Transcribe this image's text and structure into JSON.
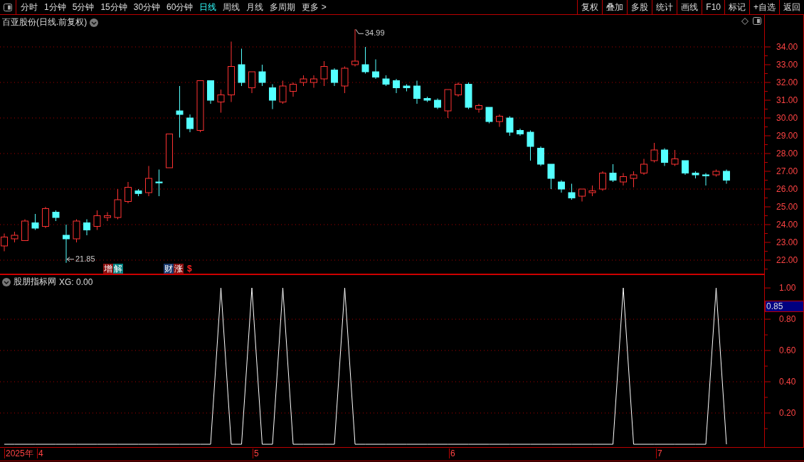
{
  "toolbar": {
    "periods": [
      {
        "label": "分时",
        "selected": false
      },
      {
        "label": "1分钟",
        "selected": false
      },
      {
        "label": "5分钟",
        "selected": false
      },
      {
        "label": "15分钟",
        "selected": false
      },
      {
        "label": "30分钟",
        "selected": false
      },
      {
        "label": "60分钟",
        "selected": false
      },
      {
        "label": "日线",
        "selected": true
      },
      {
        "label": "周线",
        "selected": false
      },
      {
        "label": "月线",
        "selected": false
      },
      {
        "label": "多周期",
        "selected": false
      },
      {
        "label": "更多 >",
        "selected": false
      }
    ],
    "buttons": [
      "复权",
      "叠加",
      "多股",
      "统计",
      "画线",
      "F10",
      "标记",
      "+自选",
      "返回"
    ]
  },
  "main_chart": {
    "title": "百亚股份(日线.前复权)",
    "high_label": "34.99",
    "low_label": "21.85",
    "event_markers": [
      [
        {
          "text": "增",
          "color": "#8b1010"
        },
        {
          "text": "解",
          "color": "#008080"
        }
      ],
      [
        {
          "text": "财",
          "color": "#1a3a6e"
        },
        {
          "text": "涨",
          "color": "#8b1010"
        }
      ],
      [
        {
          "text": "$",
          "color": "#000000"
        }
      ]
    ],
    "chart_data": {
      "type": "candlestick",
      "ylim": [
        21.2,
        35.8
      ],
      "grid": true,
      "yticks": [
        {
          "value": 34,
          "label": "34.00"
        },
        {
          "value": 33,
          "label": "33.00"
        },
        {
          "value": 32,
          "label": "32.00"
        },
        {
          "value": 31,
          "label": "31.00"
        },
        {
          "value": 30,
          "label": "30.00"
        },
        {
          "value": 29,
          "label": "29.00"
        },
        {
          "value": 28,
          "label": "28.00"
        },
        {
          "value": 27,
          "label": "27.00"
        },
        {
          "value": 26,
          "label": "26.00"
        },
        {
          "value": 25,
          "label": "25.00"
        },
        {
          "value": 24,
          "label": "24.00"
        },
        {
          "value": 23,
          "label": "23.00"
        },
        {
          "value": 22,
          "label": "22.00"
        }
      ],
      "ohlc": [
        [
          22.8,
          23.5,
          22.5,
          23.3
        ],
        [
          23.2,
          23.6,
          23.0,
          23.4
        ],
        [
          23.1,
          24.3,
          23.1,
          24.2
        ],
        [
          24.1,
          24.6,
          23.7,
          23.8
        ],
        [
          23.9,
          25.0,
          23.8,
          24.9
        ],
        [
          24.7,
          24.8,
          24.2,
          24.4
        ],
        [
          23.4,
          24.0,
          21.85,
          23.2
        ],
        [
          23.2,
          24.3,
          23.0,
          24.2
        ],
        [
          24.1,
          24.3,
          23.4,
          23.7
        ],
        [
          23.9,
          24.8,
          23.7,
          24.5
        ],
        [
          24.4,
          24.7,
          24.2,
          24.5
        ],
        [
          24.4,
          26.0,
          24.3,
          25.4
        ],
        [
          25.3,
          26.4,
          25.2,
          26.1
        ],
        [
          25.9,
          26.0,
          25.6,
          25.75
        ],
        [
          25.8,
          27.3,
          25.6,
          26.6
        ],
        [
          26.4,
          27.1,
          25.6,
          26.35
        ],
        [
          27.2,
          29.1,
          27.2,
          29.1
        ],
        [
          30.4,
          31.8,
          28.9,
          30.2
        ],
        [
          30.0,
          30.2,
          29.2,
          29.4
        ],
        [
          29.3,
          32.1,
          29.2,
          32.1
        ],
        [
          32.1,
          32.1,
          30.8,
          31.0
        ],
        [
          30.9,
          31.6,
          30.3,
          31.3
        ],
        [
          31.3,
          34.3,
          30.9,
          32.9
        ],
        [
          33.0,
          33.9,
          31.8,
          32.0
        ],
        [
          31.7,
          32.6,
          31.4,
          32.6
        ],
        [
          32.6,
          33.0,
          31.8,
          32.0
        ],
        [
          31.7,
          31.9,
          30.5,
          31.0
        ],
        [
          30.9,
          32.1,
          30.8,
          31.8
        ],
        [
          31.5,
          32.0,
          31.2,
          31.9
        ],
        [
          32.0,
          32.4,
          31.8,
          32.2
        ],
        [
          32.0,
          32.4,
          31.7,
          32.2
        ],
        [
          32.2,
          33.2,
          31.8,
          32.9
        ],
        [
          32.7,
          32.8,
          31.8,
          32.0
        ],
        [
          31.8,
          32.9,
          31.4,
          32.8
        ],
        [
          33.0,
          34.99,
          32.9,
          33.2
        ],
        [
          33.0,
          34.0,
          32.5,
          32.6
        ],
        [
          32.6,
          33.3,
          32.2,
          32.3
        ],
        [
          32.2,
          32.4,
          31.8,
          31.9
        ],
        [
          32.1,
          32.2,
          31.4,
          31.7
        ],
        [
          31.8,
          31.9,
          31.5,
          31.7
        ],
        [
          31.8,
          32.1,
          30.8,
          31.1
        ],
        [
          31.1,
          31.2,
          30.9,
          31.0
        ],
        [
          31.0,
          31.1,
          30.5,
          30.6
        ],
        [
          30.4,
          31.6,
          30.0,
          31.6
        ],
        [
          31.3,
          32.0,
          31.2,
          31.9
        ],
        [
          31.9,
          32.0,
          30.5,
          30.6
        ],
        [
          30.5,
          30.8,
          30.3,
          30.7
        ],
        [
          30.6,
          30.6,
          29.7,
          29.8
        ],
        [
          29.8,
          30.2,
          29.5,
          30.1
        ],
        [
          30.0,
          30.1,
          29.0,
          29.2
        ],
        [
          29.3,
          29.4,
          29.0,
          29.1
        ],
        [
          29.2,
          29.3,
          27.6,
          28.4
        ],
        [
          28.3,
          28.4,
          27.3,
          27.4
        ],
        [
          27.4,
          27.4,
          26.0,
          26.6
        ],
        [
          26.4,
          26.5,
          25.8,
          26.0
        ],
        [
          25.8,
          26.3,
          25.4,
          25.5
        ],
        [
          25.6,
          26.0,
          25.3,
          26.0
        ],
        [
          25.8,
          26.2,
          25.6,
          25.9
        ],
        [
          26.0,
          27.0,
          25.9,
          26.9
        ],
        [
          26.9,
          27.4,
          26.4,
          26.5
        ],
        [
          26.4,
          26.9,
          26.2,
          26.7
        ],
        [
          26.6,
          27.0,
          26.1,
          26.8
        ],
        [
          26.9,
          27.7,
          26.8,
          27.4
        ],
        [
          27.6,
          28.6,
          27.5,
          28.2
        ],
        [
          28.2,
          28.3,
          27.3,
          27.5
        ],
        [
          27.4,
          28.2,
          27.3,
          27.7
        ],
        [
          27.6,
          27.6,
          26.8,
          26.9
        ],
        [
          26.9,
          27.0,
          26.6,
          26.8
        ],
        [
          26.8,
          26.9,
          26.2,
          26.75
        ],
        [
          26.8,
          27.1,
          26.7,
          27.0
        ],
        [
          27.0,
          27.1,
          26.3,
          26.5
        ]
      ]
    }
  },
  "indicator": {
    "title": "股朋指标网",
    "reading": ": 0.00",
    "cursor_value": "0.85",
    "chart_data": {
      "type": "line",
      "ylim": [
        -0.018,
        1.087
      ],
      "grid": true,
      "yticks": [
        {
          "value": 0.2,
          "label": "0.20"
        },
        {
          "value": 0.4,
          "label": "0.40"
        },
        {
          "value": 0.6,
          "label": "0.60"
        },
        {
          "value": 0.8,
          "label": "0.80"
        },
        {
          "value": 1.0,
          "label": "1.00"
        }
      ],
      "series": [
        {
          "name": "XG",
          "color": "#ffffff",
          "values": [
            0,
            0,
            0,
            0,
            0,
            0,
            0,
            0,
            0,
            0,
            0,
            0,
            0,
            0,
            0,
            0,
            0,
            0,
            0,
            0,
            0,
            1,
            0,
            0,
            1,
            0,
            0,
            1,
            0,
            0,
            0,
            0,
            0,
            1,
            0,
            0,
            0,
            0,
            0,
            0,
            0,
            0,
            0,
            0,
            0,
            0,
            0,
            0,
            0,
            0,
            0,
            0,
            0,
            0,
            0,
            0,
            0,
            0,
            0,
            0,
            1,
            0,
            0,
            0,
            0,
            0,
            0,
            0,
            0,
            1,
            0
          ]
        }
      ]
    }
  },
  "date_axis": [
    "2025年",
    "4",
    "5",
    "6",
    "7"
  ]
}
